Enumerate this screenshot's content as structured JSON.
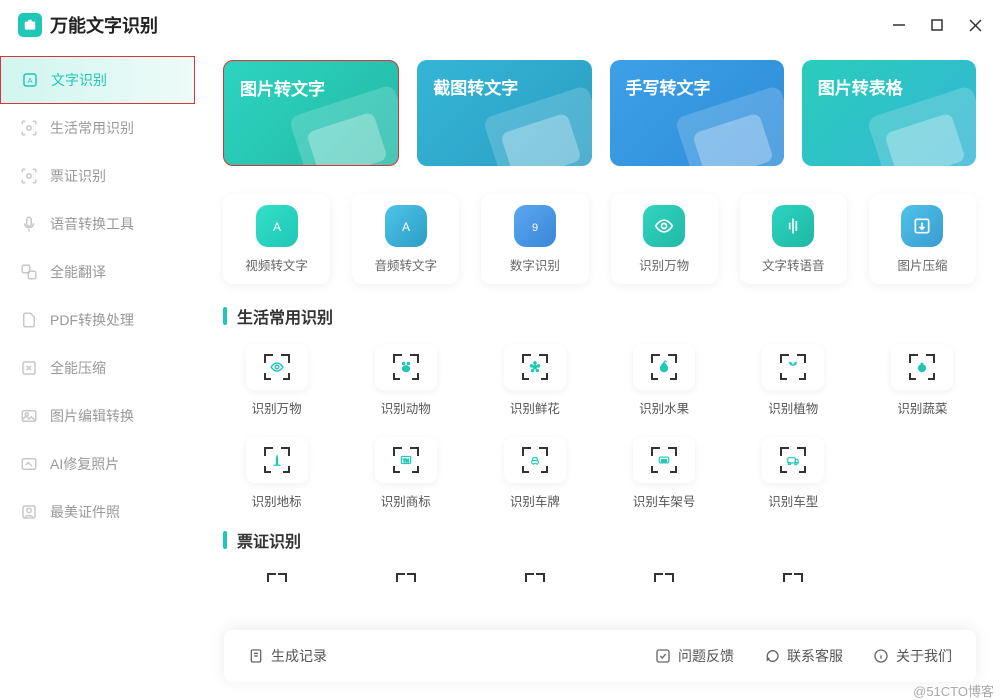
{
  "app": {
    "title": "万能文字识别"
  },
  "sidebar": {
    "items": [
      {
        "label": "文字识别"
      },
      {
        "label": "生活常用识别"
      },
      {
        "label": "票证识别"
      },
      {
        "label": "语音转换工具"
      },
      {
        "label": "全能翻译"
      },
      {
        "label": "PDF转换处理"
      },
      {
        "label": "全能压缩"
      },
      {
        "label": "图片编辑转换"
      },
      {
        "label": "AI修复照片"
      },
      {
        "label": "最美证件照"
      }
    ]
  },
  "hero": [
    {
      "label": "图片转文字"
    },
    {
      "label": "截图转文字"
    },
    {
      "label": "手写转文字"
    },
    {
      "label": "图片转表格"
    }
  ],
  "tools": [
    {
      "label": "视频转文字"
    },
    {
      "label": "音频转文字"
    },
    {
      "label": "数字识别"
    },
    {
      "label": "识别万物"
    },
    {
      "label": "文字转语音"
    },
    {
      "label": "图片压缩"
    }
  ],
  "section1": {
    "title": "生活常用识别"
  },
  "recog1": [
    {
      "label": "识别万物"
    },
    {
      "label": "识别动物"
    },
    {
      "label": "识别鲜花"
    },
    {
      "label": "识别水果"
    },
    {
      "label": "识别植物"
    },
    {
      "label": "识别蔬菜"
    },
    {
      "label": "识别地标"
    },
    {
      "label": "识别商标"
    },
    {
      "label": "识别车牌"
    },
    {
      "label": "识别车架号"
    },
    {
      "label": "识别车型"
    }
  ],
  "section2": {
    "title": "票证识别"
  },
  "bottom": {
    "records": "生成记录",
    "feedback": "问题反馈",
    "support": "联系客服",
    "about": "关于我们"
  },
  "watermark": "@51CTO博客"
}
